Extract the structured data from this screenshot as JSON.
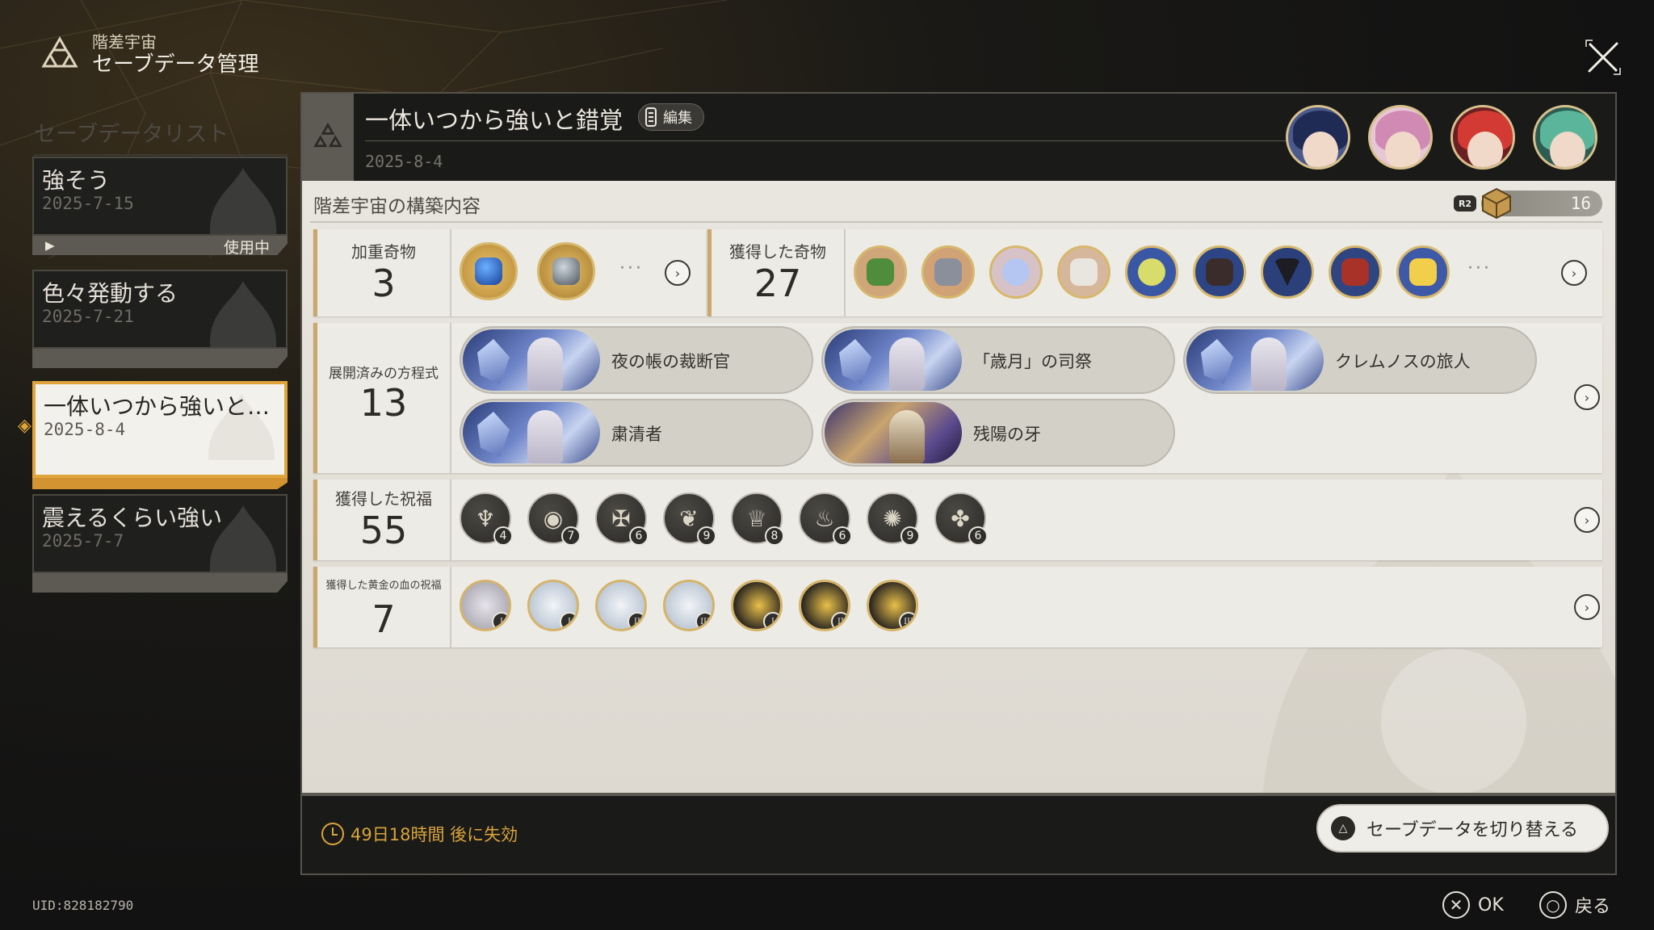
{
  "header": {
    "subtitle": "階差宇宙",
    "title": "セーブデータ管理"
  },
  "save_list": {
    "title": "セーブデータリスト",
    "items": [
      {
        "name": "強そう",
        "date": "2025-7-15",
        "status": "使用中"
      },
      {
        "name": "色々発動する",
        "date": "2025-7-21"
      },
      {
        "name": "一体いつから強いと…",
        "date": "2025-8-4",
        "selected": true
      },
      {
        "name": "震えるくらい強い",
        "date": "2025-7-7"
      }
    ]
  },
  "detail": {
    "save_title": "一体いつから強いと錯覚",
    "edit_label": "編集",
    "date": "2025-8-4",
    "section_title": "階差宇宙の構築内容",
    "r2_label": "R2",
    "level": "16",
    "weighted_curio": {
      "label": "加重奇物",
      "count": "3"
    },
    "obtained_curio": {
      "label": "獲得した奇物",
      "count": "27"
    },
    "equations": {
      "label": "展開済みの方程式",
      "count": "13",
      "items": [
        {
          "name": "夜の帳の裁断官"
        },
        {
          "name": "「歳月」の司祭"
        },
        {
          "name": "クレムノスの旅人"
        },
        {
          "name": "粛清者"
        },
        {
          "name": "残陽の牙"
        }
      ]
    },
    "blessings": {
      "label": "獲得した祝福",
      "count": "55",
      "items": [
        {
          "icon": "flame-blessing-icon",
          "n": "4"
        },
        {
          "icon": "eye-blessing-icon",
          "n": "7"
        },
        {
          "icon": "claw-blessing-icon",
          "n": "6"
        },
        {
          "icon": "lotus-blessing-icon",
          "n": "9"
        },
        {
          "icon": "chalice-blessing-icon",
          "n": "8"
        },
        {
          "icon": "fire-blessing-icon",
          "n": "6"
        },
        {
          "icon": "gear-blessing-icon",
          "n": "9"
        },
        {
          "icon": "spiral-blessing-icon",
          "n": "6"
        }
      ]
    },
    "golden_blessings": {
      "label": "獲得した黄金の血の祝福",
      "count": "7",
      "items": [
        {
          "tier": "I"
        },
        {
          "tier": "I"
        },
        {
          "tier": "II"
        },
        {
          "tier": "III"
        },
        {
          "tier": "I"
        },
        {
          "tier": "II"
        },
        {
          "tier": "III"
        }
      ]
    },
    "expire_text": "49日18時間 後に失効",
    "switch_label": "セーブデータを切り替える"
  },
  "footer": {
    "uid": "UID:828182790",
    "ok_label": "OK",
    "back_label": "戻る"
  },
  "colors": {
    "accent_gold": "#e0a43a",
    "panel_light": "#e9e6df",
    "dark_bg": "#1b1b1a"
  }
}
